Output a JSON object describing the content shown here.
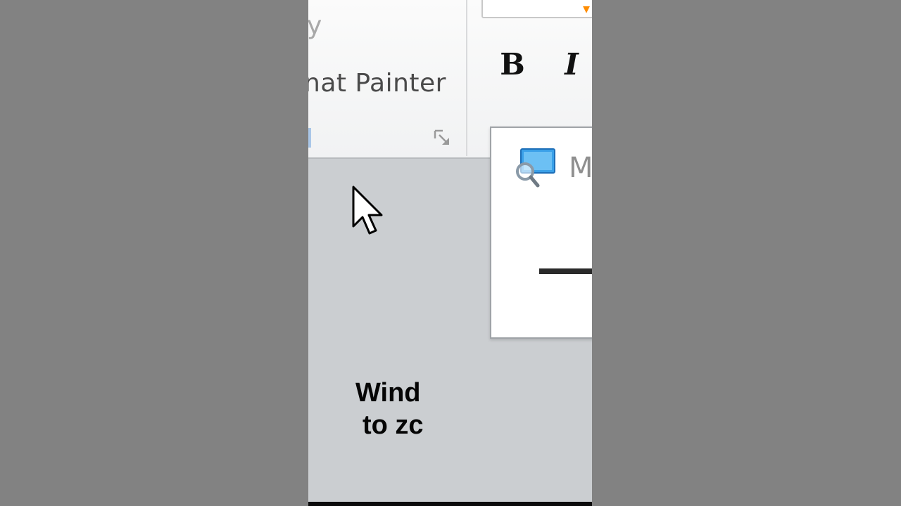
{
  "ribbon": {
    "clipboard_group": {
      "fragment_text": "y",
      "format_painter_label": "nat Painter",
      "launcher_icon": "dialog-launcher-icon"
    },
    "font_group": {
      "bold_label": "B",
      "italic_label": "I",
      "font_box_arrow": "▾"
    }
  },
  "magnifier": {
    "icon": "magnifier-icon",
    "title_fragment": "M",
    "minimize_icon": "minimize-icon"
  },
  "cursor": {
    "icon": "mouse-pointer-icon"
  },
  "caption": {
    "line1": "Wind",
    "line2": "to zc"
  },
  "colors": {
    "side_bars": "#828282",
    "workspace": "#cbced1",
    "ribbon": "#f4f5f6",
    "magnifier_accent": "#3aa0e8"
  }
}
